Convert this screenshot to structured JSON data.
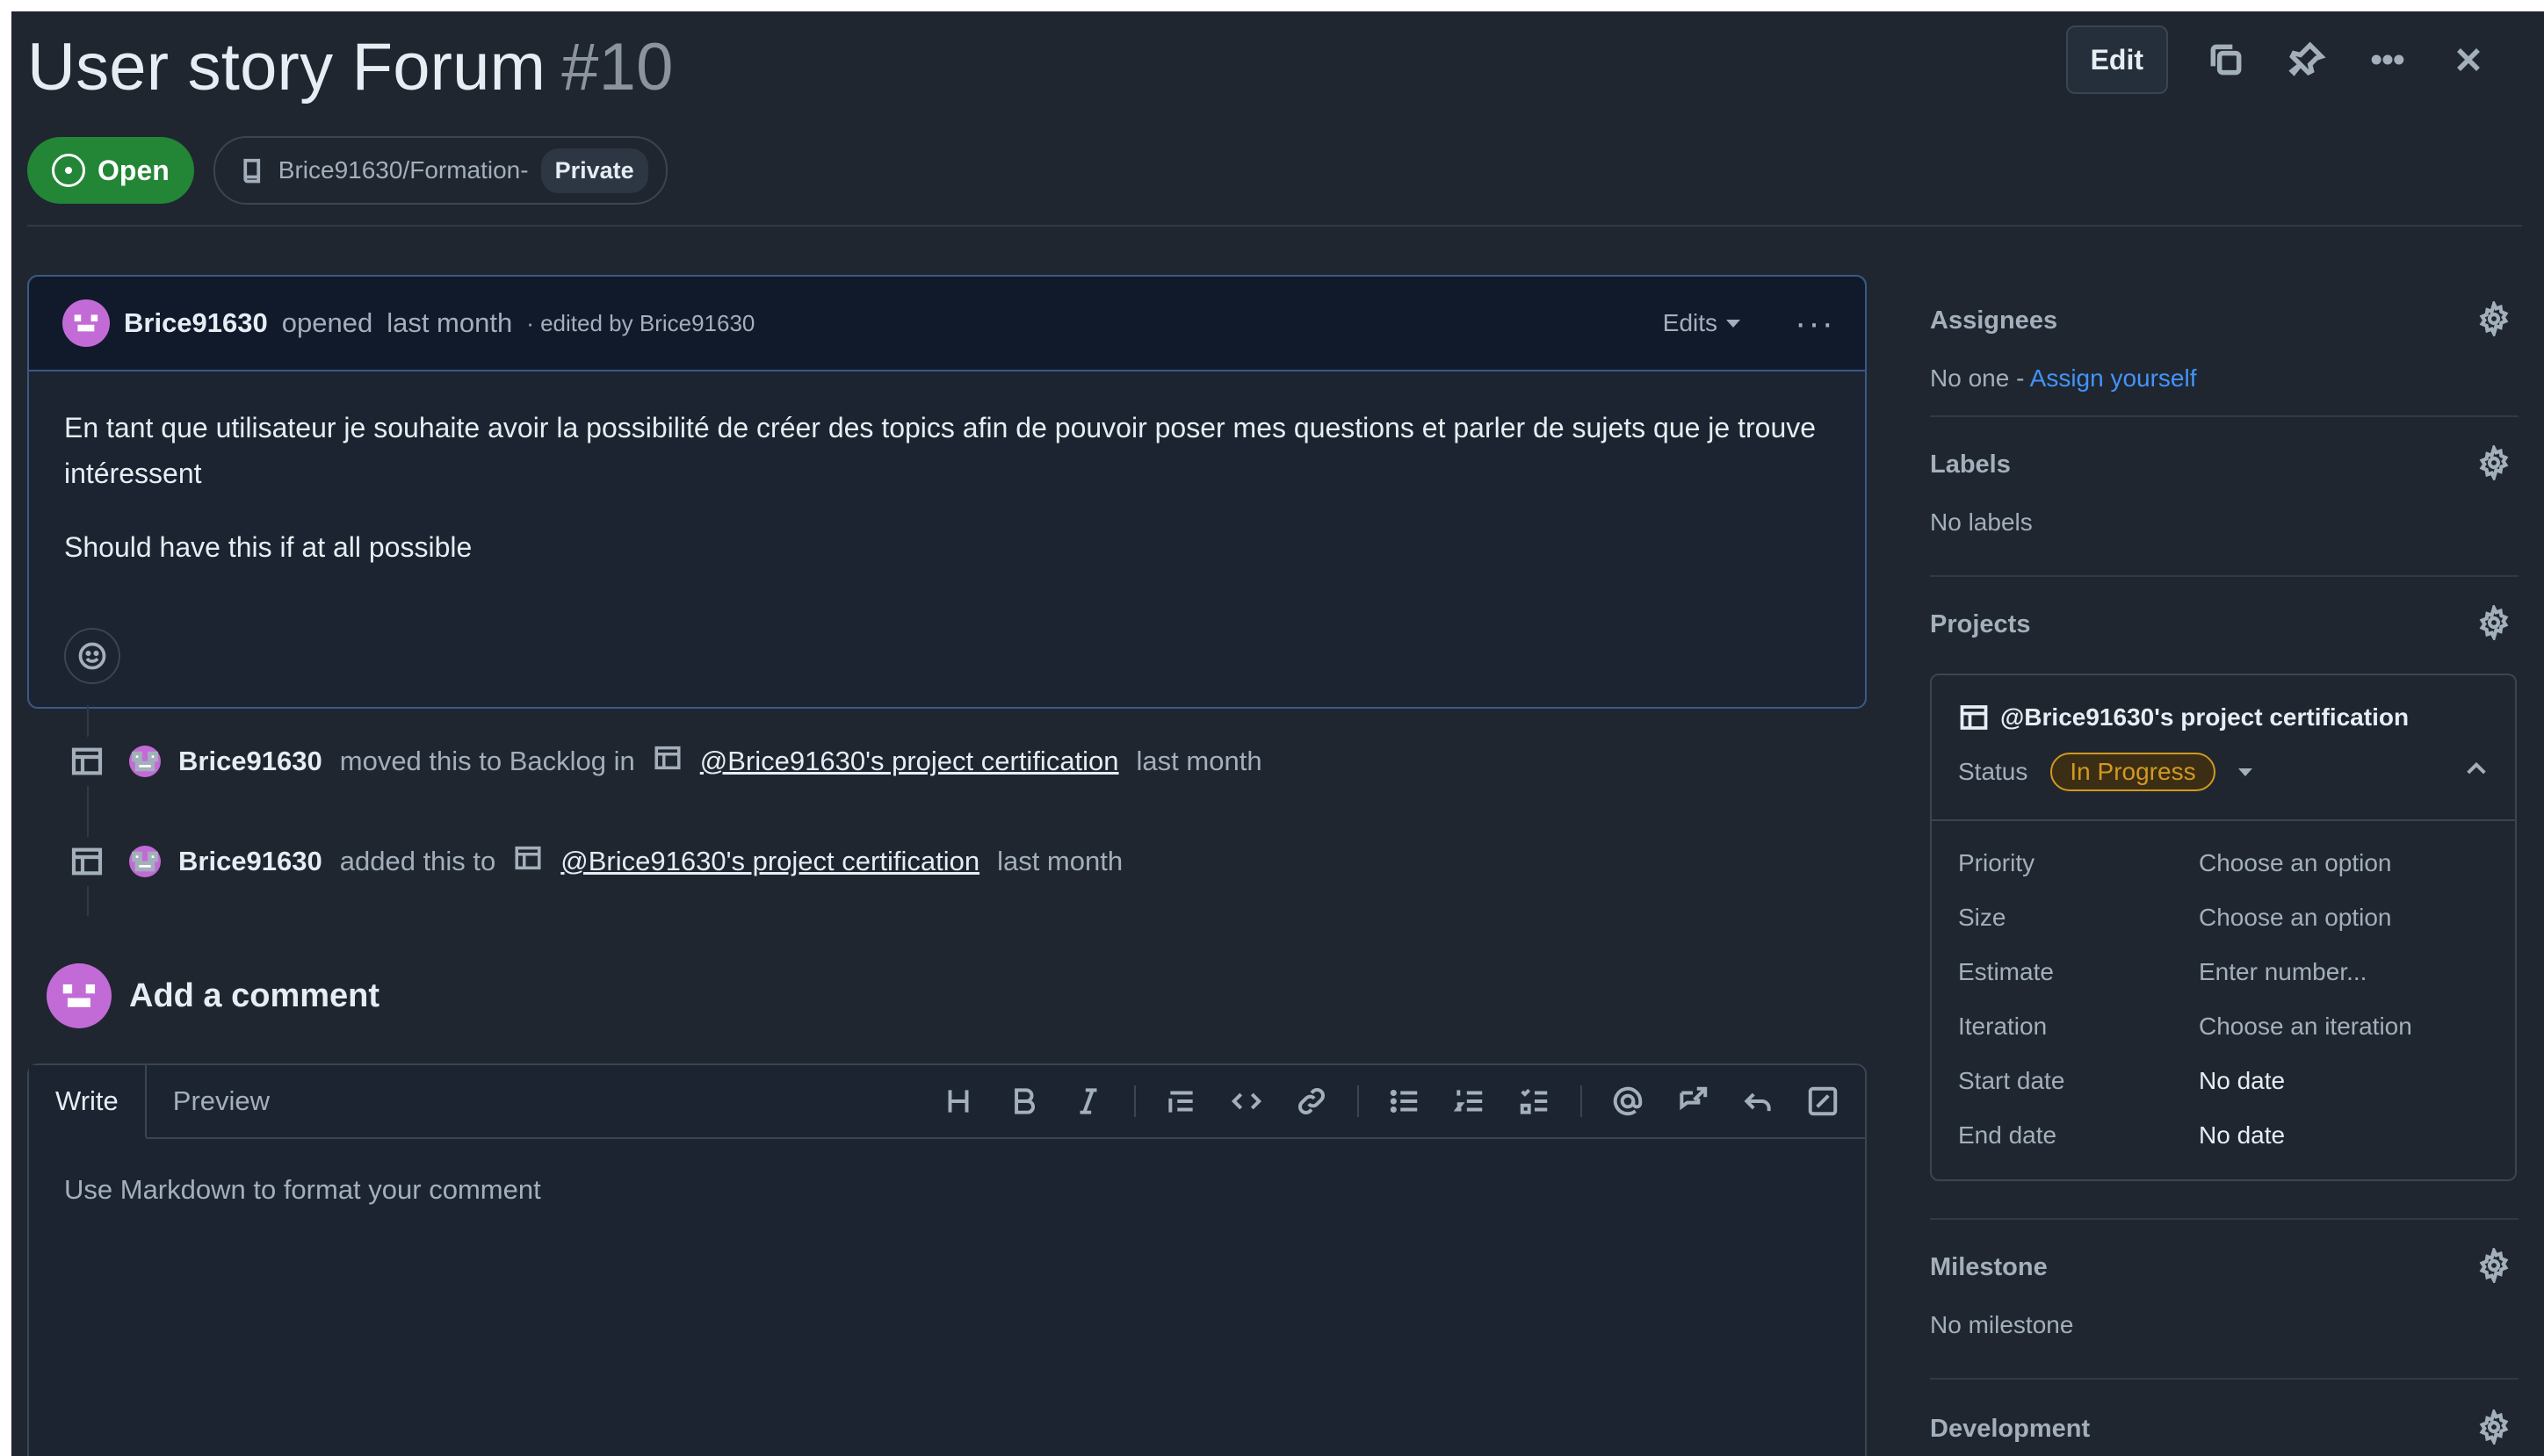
{
  "issue": {
    "title": "User story Forum",
    "number": "#10",
    "state": "Open",
    "repo": "Brice91630/Formation-",
    "visibility": "Private"
  },
  "header": {
    "edit_label": "Edit"
  },
  "comment": {
    "author": "Brice91630",
    "action": "opened",
    "time": "last month",
    "edited_note": "· edited by Brice91630",
    "edits_label": "Edits",
    "body_p1": "En tant que utilisateur je souhaite avoir la possibilité de créer des topics afin de pouvoir poser mes questions et parler de sujets que je trouve intéressent",
    "body_p2": "Should have this if at all possible"
  },
  "timeline": [
    {
      "actor": "Brice91630",
      "text": "moved this to Backlog in",
      "project": "@Brice91630's project certification",
      "time": "last month"
    },
    {
      "actor": "Brice91630",
      "text": "added this to",
      "project": "@Brice91630's project certification",
      "time": "last month"
    }
  ],
  "add_comment": {
    "heading": "Add a comment",
    "tab_write": "Write",
    "tab_preview": "Preview",
    "placeholder": "Use Markdown to format your comment"
  },
  "sidebar": {
    "assignees": {
      "title": "Assignees",
      "value": "No one - ",
      "link": "Assign yourself"
    },
    "labels": {
      "title": "Labels",
      "value": "No labels"
    },
    "projects": {
      "title": "Projects",
      "project_name": "@Brice91630's project certification",
      "status_label": "Status",
      "status_value": "In Progress",
      "fields": [
        {
          "key": "Priority",
          "value": "Choose an option"
        },
        {
          "key": "Size",
          "value": "Choose an option"
        },
        {
          "key": "Estimate",
          "value": "Enter number..."
        },
        {
          "key": "Iteration",
          "value": "Choose an iteration"
        },
        {
          "key": "Start date",
          "value": "No date"
        },
        {
          "key": "End date",
          "value": "No date"
        }
      ]
    },
    "milestone": {
      "title": "Milestone",
      "value": "No milestone"
    },
    "development": {
      "title": "Development"
    }
  },
  "colors": {
    "background": "#1f2630",
    "open_green": "#238636",
    "link_blue": "#4493f8",
    "status_orange": "#d29922"
  }
}
